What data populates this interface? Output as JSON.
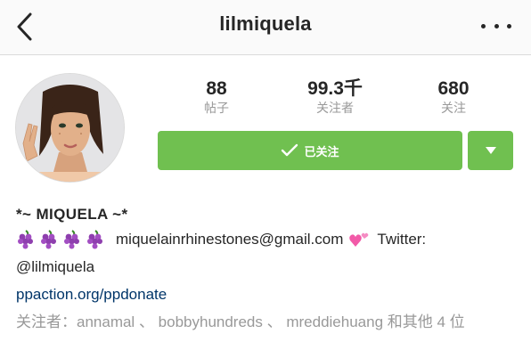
{
  "header": {
    "title": "lilmiquela",
    "back_icon": "chevron-left-icon",
    "more_icon": "more-horizontal-icon"
  },
  "stats": {
    "posts": {
      "count": "88",
      "label": "帖子"
    },
    "followers": {
      "count": "99.3千",
      "label": "关注者"
    },
    "following": {
      "count": "680",
      "label": "关注"
    }
  },
  "actions": {
    "follow_label": "已关注",
    "follow_icon": "checkmark-icon",
    "dropdown_icon": "caret-down-icon",
    "accent_color": "#70c050"
  },
  "profile": {
    "display_name": "*~ MIQUELA ~*",
    "bio_email": "miquelainrhinestones@gmail.com",
    "bio_twitter_label": "Twitter:",
    "bio_twitter_handle": "@lilmiquela",
    "bio_emojis": [
      "grapes-emoji",
      "grapes-emoji",
      "grapes-emoji",
      "grapes-emoji",
      "two-hearts-emoji"
    ],
    "website": "ppaction.org/ppdonate"
  },
  "followed_by": {
    "prefix": "关注者：",
    "users": [
      "annamal",
      "bobbyhundreds",
      "mreddiehuang"
    ],
    "separator": " 、 ",
    "suffix": " 和其他 4 位"
  }
}
